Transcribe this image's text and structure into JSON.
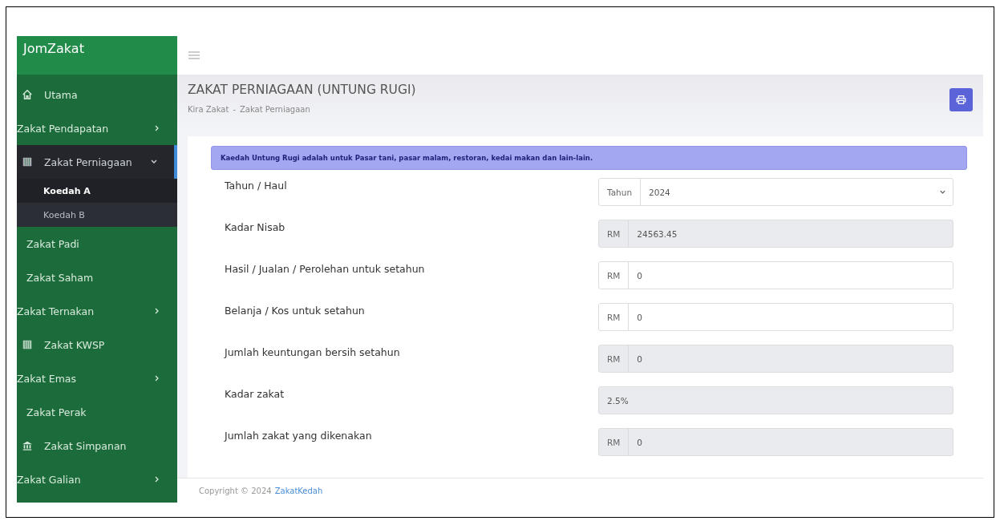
{
  "brand": "JomZakat",
  "sidebar": {
    "items": [
      {
        "label": "Utama",
        "kind": "link",
        "selected": false
      },
      {
        "label": "Zakat Pendapatan",
        "kind": "group",
        "expanded": false,
        "selected": false
      },
      {
        "label": "Zakat Perniagaan",
        "kind": "group",
        "expanded": true,
        "selected": true,
        "children": [
          {
            "label": "Koedah A",
            "selected": true
          },
          {
            "label": "Koedah B",
            "selected": false
          }
        ]
      },
      {
        "label": "Zakat Padi",
        "kind": "link",
        "selected": false
      },
      {
        "label": "Zakat Saham",
        "kind": "link",
        "selected": false
      },
      {
        "label": "Zakat Ternakan",
        "kind": "group",
        "expanded": false,
        "selected": false
      },
      {
        "label": "Zakat KWSP",
        "kind": "link",
        "selected": false
      },
      {
        "label": "Zakat Emas",
        "kind": "group",
        "expanded": false,
        "selected": false
      },
      {
        "label": "Zakat Perak",
        "kind": "link",
        "selected": false
      },
      {
        "label": "Zakat Simpanan",
        "kind": "link",
        "selected": false
      },
      {
        "label": "Zakat Galian",
        "kind": "group",
        "expanded": false,
        "selected": false
      }
    ]
  },
  "page": {
    "title": "ZAKAT PERNIAGAAN (UNTUNG RUGI)",
    "breadcrumb": [
      "Kira Zakat",
      "Zakat Perniagaan"
    ],
    "breadcrumb_separator": "-"
  },
  "alert": "Kaedah Untung Rugi adalah untuk Pasar tani, pasar malam, restoran, kedai makan dan lain-lain.",
  "fields": [
    {
      "label": "Tahun / Haul",
      "kind": "select",
      "prefix": "Tahun",
      "value": "2024"
    },
    {
      "label": "Kadar Nisab",
      "kind": "readonly",
      "prefix": "RM",
      "value": "24563.45"
    },
    {
      "label": "Hasil / Jualan / Perolehan untuk setahun",
      "kind": "input",
      "prefix": "RM",
      "value": "0"
    },
    {
      "label": "Belanja / Kos untuk setahun",
      "kind": "input",
      "prefix": "RM",
      "value": "0"
    },
    {
      "label": "Jumlah keuntungan bersih setahun",
      "kind": "readonly",
      "prefix": "RM",
      "value": "0"
    },
    {
      "label": "Kadar zakat",
      "kind": "readonly",
      "value": "2.5%"
    },
    {
      "label": "Jumlah zakat yang dikenakan",
      "kind": "readonly",
      "prefix": "RM",
      "value": "0"
    }
  ],
  "footer": {
    "text": "Copyright © 2024",
    "link": "ZakatKedah"
  }
}
